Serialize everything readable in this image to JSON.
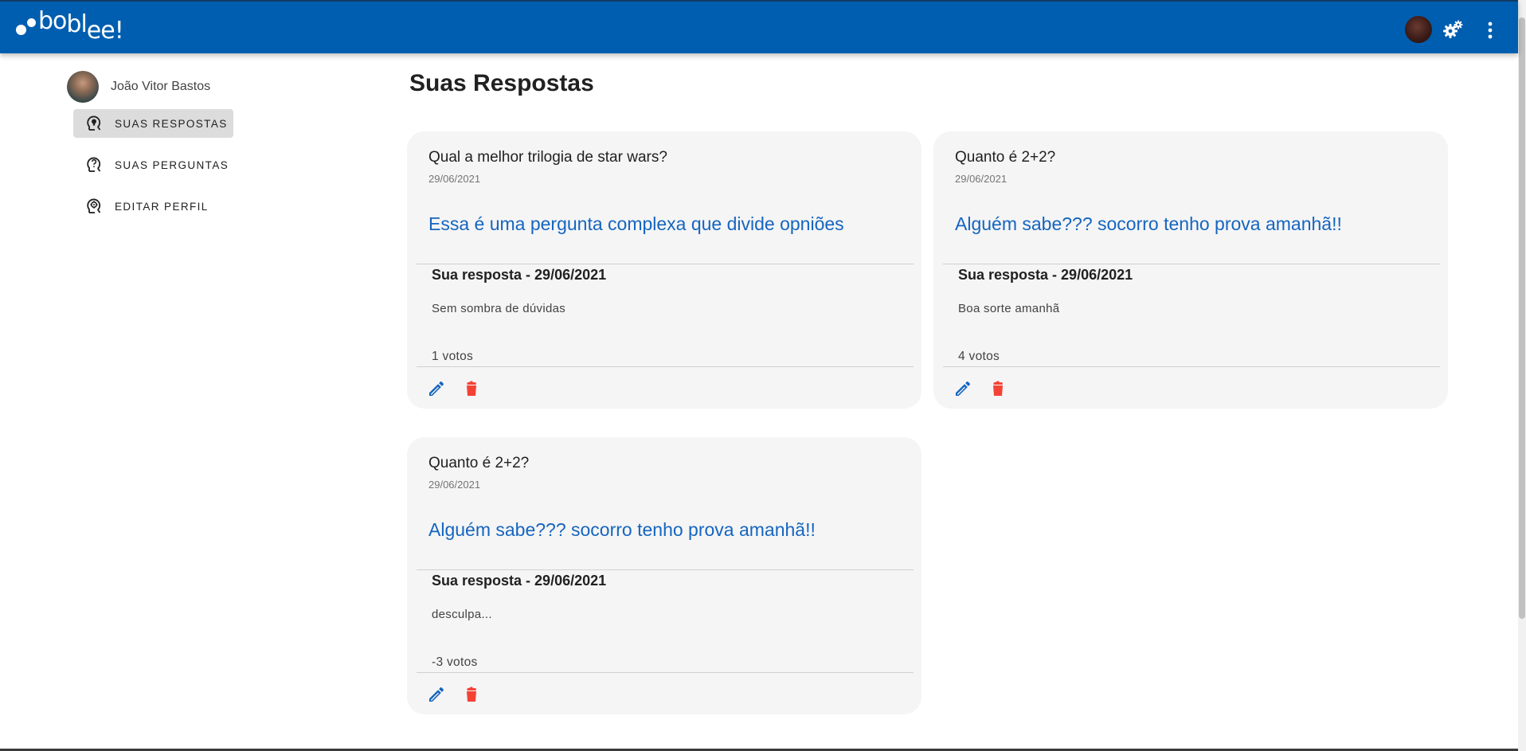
{
  "app": {
    "logo_text_1": "bo",
    "logo_text_2": "bl",
    "logo_text_3": "ee!",
    "colors": {
      "primary": "#005eb0",
      "link": "#1565c0",
      "danger": "#f44336",
      "card_bg": "#f5f5f5"
    }
  },
  "toolbar": {
    "account_icon": "avatar",
    "settings_icon": "gears-icon",
    "menu_icon": "more-vert-icon"
  },
  "sidebar": {
    "user_name": "João Vitor Bastos",
    "items": [
      {
        "label": "SUAS RESPOSTAS",
        "icon": "head-lightbulb-icon",
        "active": true
      },
      {
        "label": "SUAS PERGUNTAS",
        "icon": "head-question-icon",
        "active": false
      },
      {
        "label": "EDITAR PERFIL",
        "icon": "head-cog-icon",
        "active": false
      }
    ]
  },
  "main": {
    "title": "Suas Respostas",
    "cards": [
      {
        "question_title": "Qual a melhor trilogia de star wars?",
        "question_date": "29/06/2021",
        "question_body": "Essa é uma pergunta complexa que divide opniões",
        "answer_heading": "Sua resposta - 29/06/2021",
        "answer_body": "Sem sombra de dúvidas",
        "votes": "1 votos"
      },
      {
        "question_title": "Quanto é 2+2?",
        "question_date": "29/06/2021",
        "question_body": "Alguém sabe??? socorro tenho prova amanhã!!",
        "answer_heading": "Sua resposta - 29/06/2021",
        "answer_body": "Boa sorte amanhã",
        "votes": "4 votos"
      },
      {
        "question_title": "Quanto é 2+2?",
        "question_date": "29/06/2021",
        "question_body": "Alguém sabe??? socorro tenho prova amanhã!!",
        "answer_heading": "Sua resposta - 29/06/2021",
        "answer_body": "desculpa...",
        "votes": "-3 votos"
      }
    ]
  }
}
